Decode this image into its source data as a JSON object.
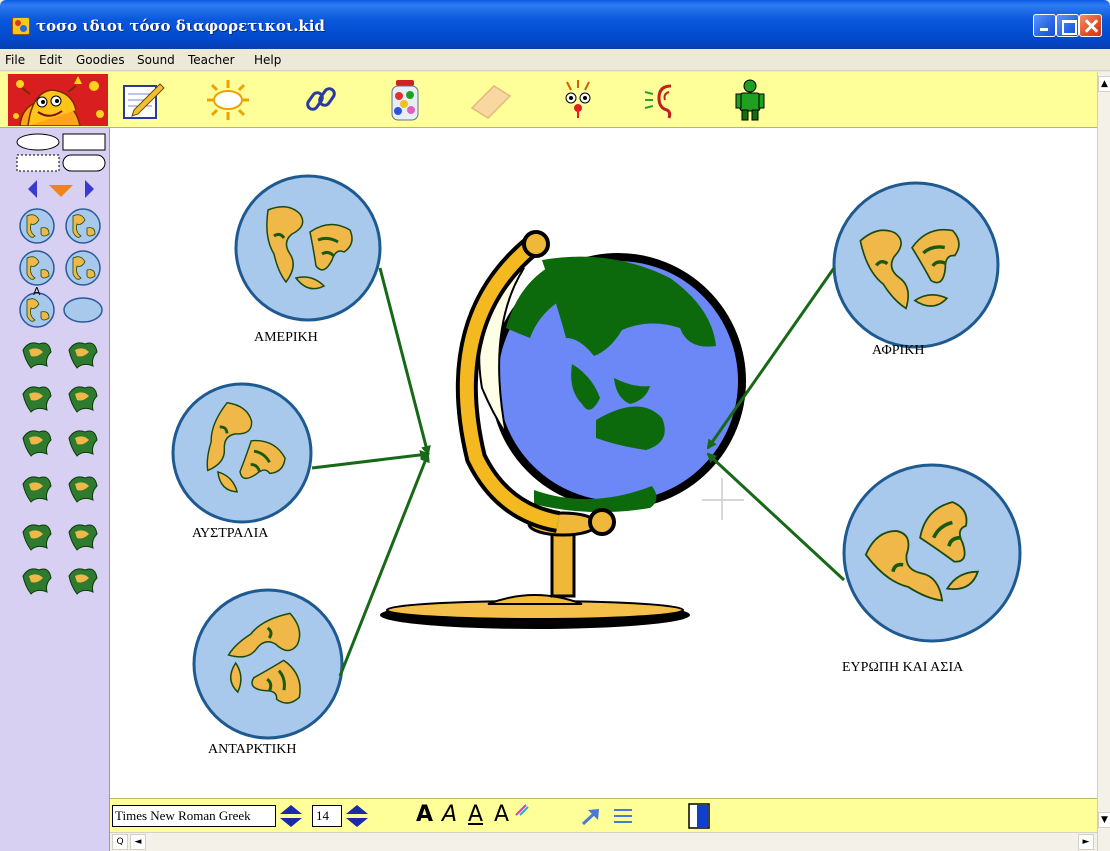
{
  "window": {
    "title": "τοσο ιδιοι τόσο διαφορετικοι.kid"
  },
  "menu": [
    "File",
    "Edit",
    "Goodies",
    "Sound",
    "Teacher",
    "Help"
  ],
  "toolbar": {
    "tools": [
      "pencil-pad-icon",
      "sun-oval-icon",
      "chain-link-icon",
      "candy-jar-icon",
      "eraser-icon",
      "funny-face-icon",
      "ear-icon",
      "person-icon"
    ]
  },
  "palette": {
    "shape_label": "A"
  },
  "canvas": {
    "labels": {
      "america": "ΑΜΕΡΙΚΗ",
      "australia": "ΑΥΣΤΡΑΛΙΑ",
      "antarctica": "ΑΝΤΑΡΚΤΙΚΗ",
      "africa": "ΑΦΡΙΚΗ",
      "europe_asia": "ΕΥΡΩΠΗ ΚΑΙ ΑΣΙΑ"
    }
  },
  "textbar": {
    "font_name": "Times New Roman Greek",
    "font_size": "14",
    "bold_glyph": "A",
    "italic_glyph": "A",
    "underline_glyph": "A",
    "color_glyph": "A"
  },
  "colors": {
    "toolbar_bg": "#ffff99",
    "palette_bg": "#d8d0f2",
    "arrow": "#176917",
    "ocean": "#a8c8ec",
    "land": "#f0b848"
  }
}
